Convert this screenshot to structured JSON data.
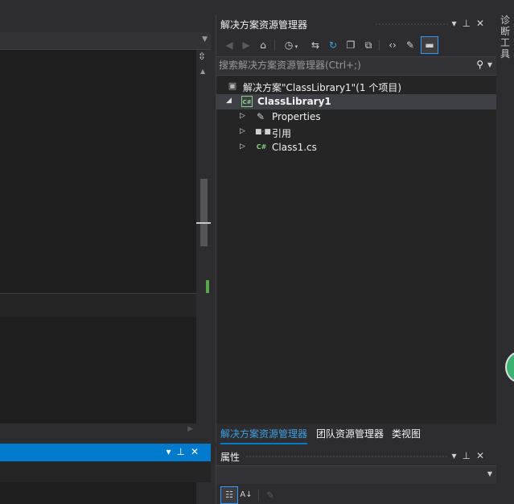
{
  "solution_explorer": {
    "title": "解决方案资源管理器",
    "title_buttons": [
      "▾",
      "⊥",
      "✕"
    ],
    "toolbar": [
      {
        "name": "back-icon",
        "glyph": "◀"
      },
      {
        "name": "forward-icon",
        "glyph": "▶"
      },
      {
        "name": "home-icon",
        "glyph": "⌂"
      },
      {
        "name": "pending-changes-filter-icon",
        "glyph": "◷"
      },
      {
        "name": "sync-with-active-document-icon",
        "glyph": "⇆"
      },
      {
        "name": "refresh-icon",
        "glyph": "↻"
      },
      {
        "name": "collapse-all-icon",
        "glyph": "❐"
      },
      {
        "name": "show-all-files-icon",
        "glyph": "⧉"
      },
      {
        "name": "view-code-icon",
        "glyph": "‹›"
      },
      {
        "name": "properties-wrench-icon",
        "glyph": "✎"
      },
      {
        "name": "preview-selected-items-icon",
        "glyph": "▬"
      }
    ],
    "search": {
      "placeholder": "搜索解决方案资源管理器(Ctrl+;)",
      "icon": "search-icon"
    },
    "tree": {
      "solution": "解决方案\"ClassLibrary1\"(1 个项目)",
      "project": "ClassLibrary1",
      "project_icon_text": "C#",
      "items": [
        {
          "label": "Properties",
          "icon": "wrench-icon"
        },
        {
          "label": "引用",
          "icon": "references-icon"
        },
        {
          "label": "Class1.cs",
          "icon": "csharp-file-icon",
          "icon_text": "C#"
        }
      ]
    },
    "tabs": [
      "解决方案资源管理器",
      "团队资源管理器",
      "类视图"
    ]
  },
  "properties": {
    "title": "属性",
    "title_buttons": [
      "▾",
      "⊥",
      "✕"
    ]
  },
  "bottom_panel": {
    "title_buttons": [
      "▾",
      "⊥",
      "✕"
    ]
  },
  "side_tool": {
    "label": "诊断工具"
  },
  "colors": {
    "accent": "#007acc",
    "background": "#2d2d30",
    "editor": "#1e1e1e",
    "panel": "#252526",
    "selected_row": "#3f3f46"
  }
}
